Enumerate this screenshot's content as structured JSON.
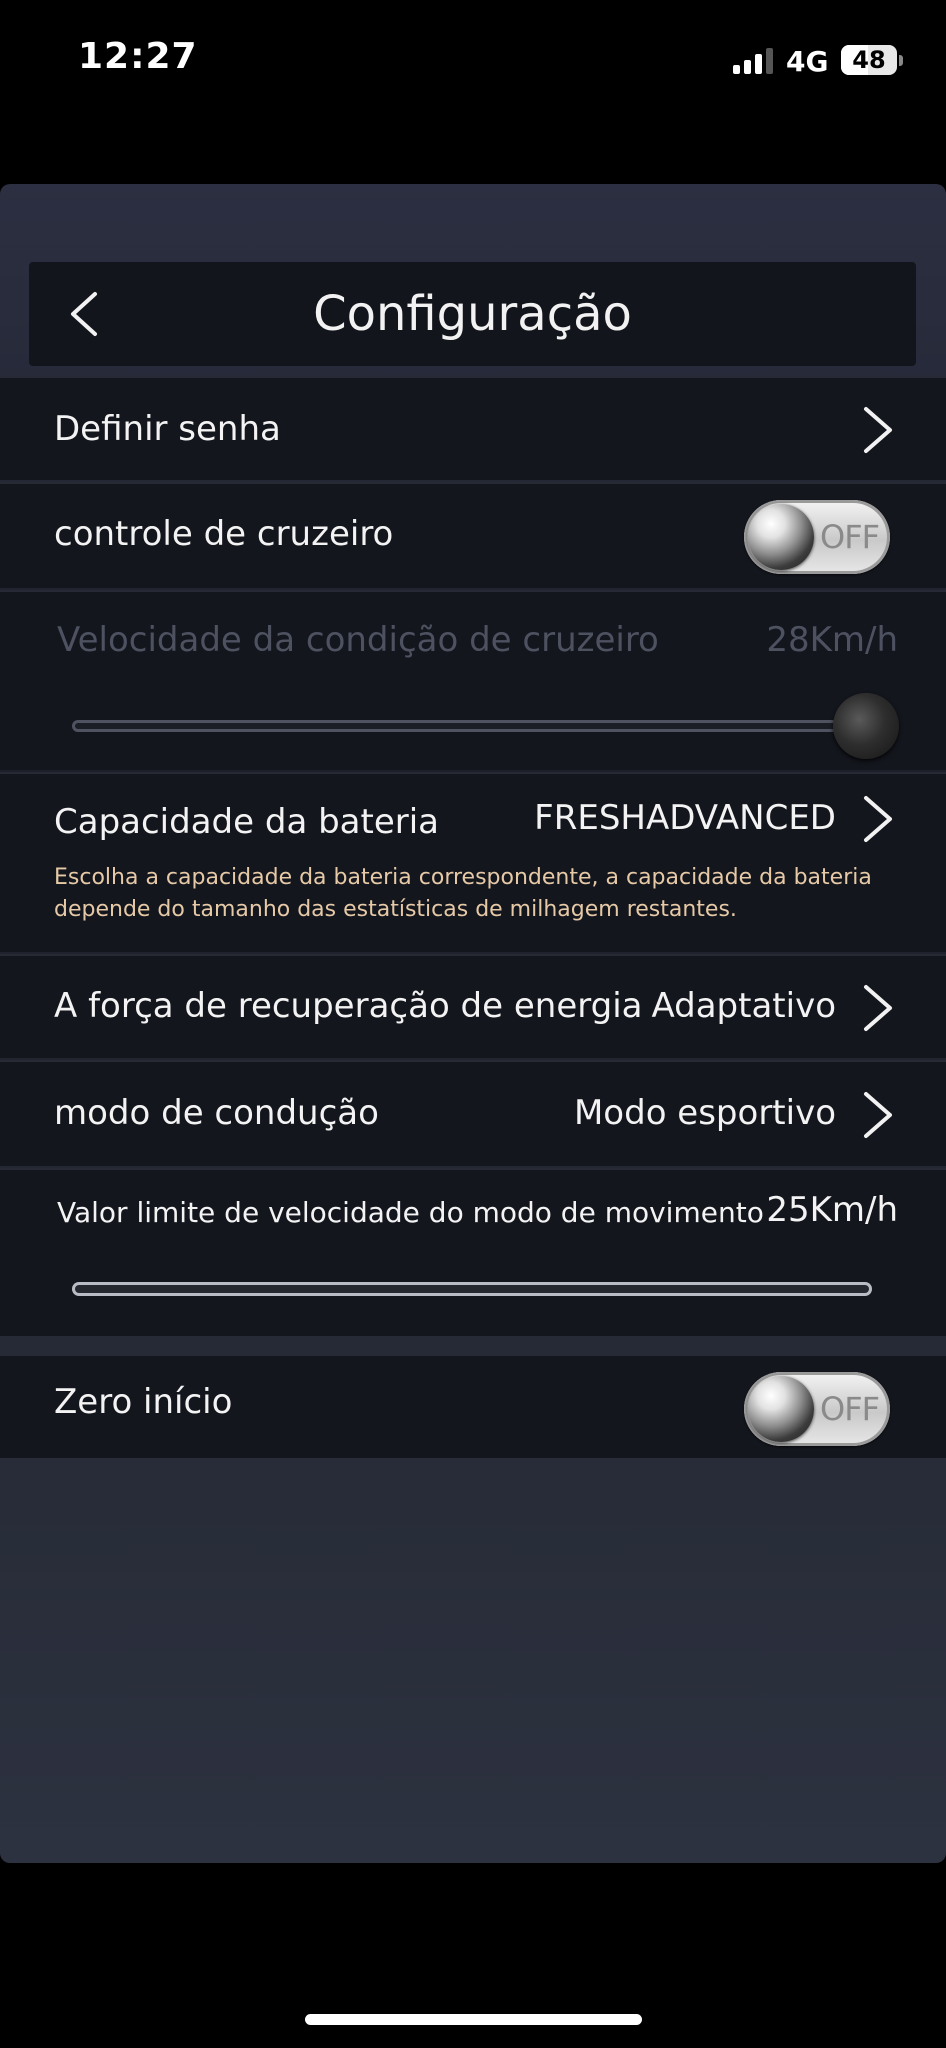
{
  "status_bar": {
    "time": "12:27",
    "network": "4G",
    "battery": "48",
    "battery_level": 0.48
  },
  "header": {
    "title": "Configuração"
  },
  "settings": {
    "password": {
      "label": "Definir senha"
    },
    "cruise_control": {
      "label": "controle de cruzeiro",
      "state": "OFF"
    },
    "cruise_speed": {
      "label": "Velocidade da condição de cruzeiro",
      "value": "28Km/h",
      "slider_fraction": 1.0
    },
    "battery_capacity": {
      "label": "Capacidade da bateria",
      "value": "FRESHADVANCED",
      "hint": "Escolha a capacidade da bateria correspondente, a capacidade da bateria depende do tamanho das estatísticas de milhagem restantes."
    },
    "energy_recovery": {
      "label": "A força de recuperação de energia",
      "value": "Adaptativo"
    },
    "driving_mode": {
      "label": "modo de condução",
      "value": "Modo esportivo"
    },
    "sport_speed_limit": {
      "label": "Valor limite de velocidade do modo de movimento",
      "value": "25Km/h"
    },
    "zero_start": {
      "label": "Zero início",
      "state": "OFF"
    }
  },
  "icons": {
    "back": "chevron-left-icon",
    "chevron": "chevron-right-icon"
  },
  "colors": {
    "panel": "#1d2029",
    "row": "#14161e",
    "hint_text": "#e6c9a6",
    "disabled_text": "#4d5160"
  }
}
